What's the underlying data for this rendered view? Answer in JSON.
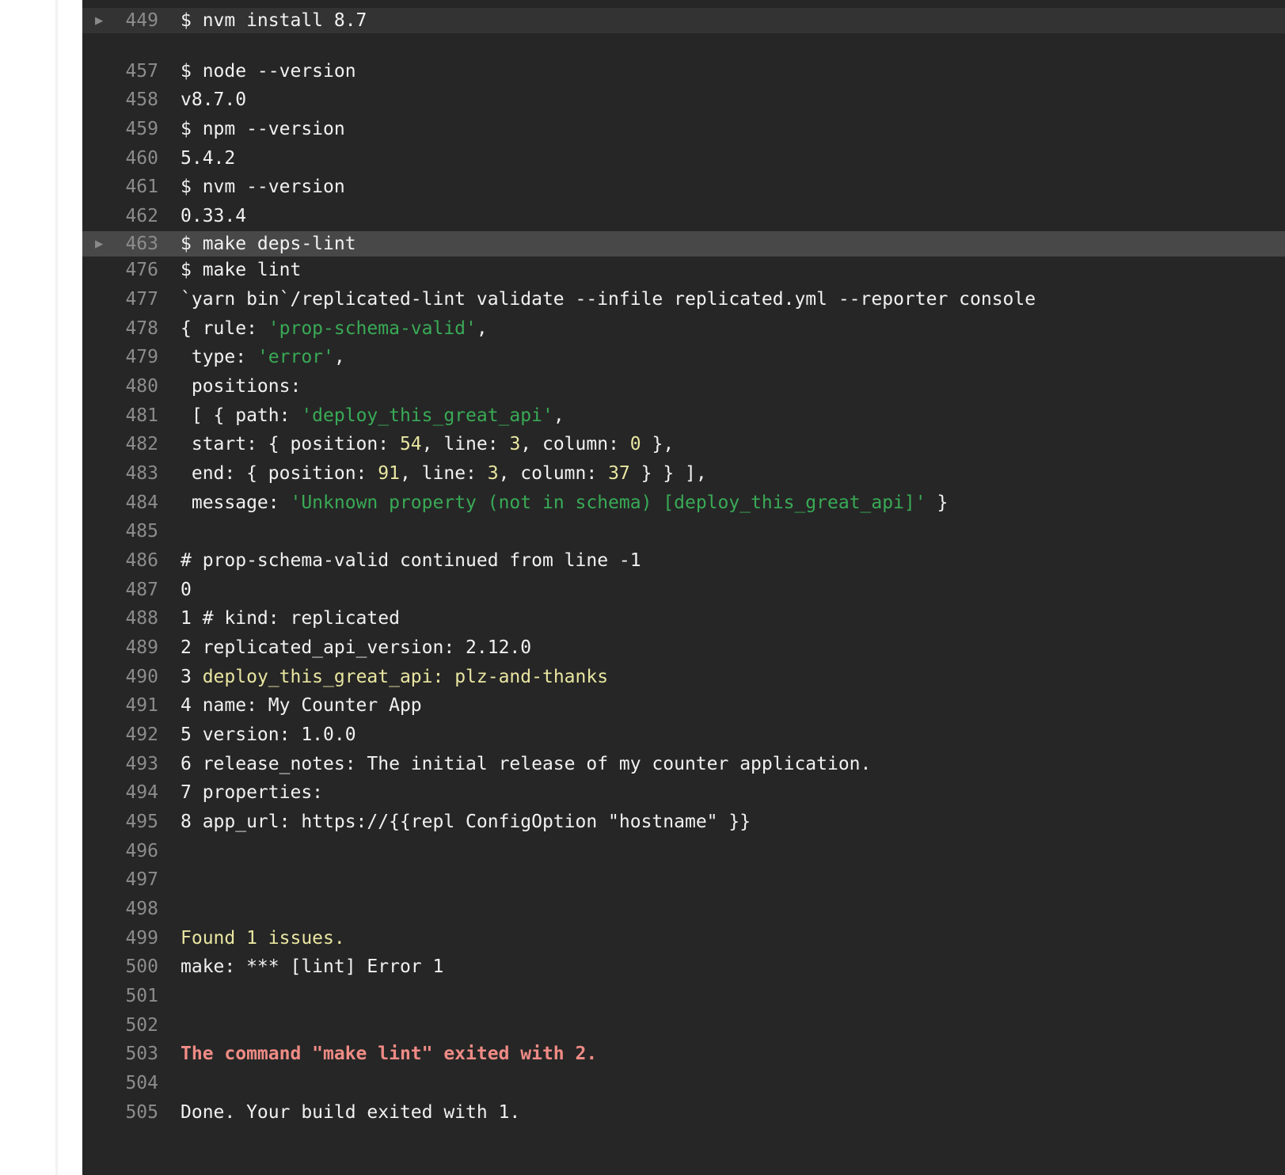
{
  "log": {
    "lines": [
      {
        "n": "449",
        "fold": true,
        "segs": [
          {
            "t": "$ nvm install 8.7"
          }
        ]
      },
      {
        "n": "457",
        "segs": [
          {
            "t": "$ node --version"
          }
        ]
      },
      {
        "n": "458",
        "segs": [
          {
            "t": "v8.7.0"
          }
        ]
      },
      {
        "n": "459",
        "segs": [
          {
            "t": "$ npm --version"
          }
        ]
      },
      {
        "n": "460",
        "segs": [
          {
            "t": "5.4.2"
          }
        ]
      },
      {
        "n": "461",
        "segs": [
          {
            "t": "$ nvm --version"
          }
        ]
      },
      {
        "n": "462",
        "segs": [
          {
            "t": "0.33.4"
          }
        ]
      },
      {
        "n": "463",
        "fold": true,
        "segs": [
          {
            "t": "$ make deps-lint"
          }
        ]
      },
      {
        "n": "476",
        "segs": [
          {
            "t": "$ make lint"
          }
        ]
      },
      {
        "n": "477",
        "segs": [
          {
            "t": "`yarn bin`/replicated-lint validate --infile replicated.yml --reporter console"
          }
        ]
      },
      {
        "n": "478",
        "segs": [
          {
            "t": "{ rule: "
          },
          {
            "t": "'prop-schema-valid'",
            "c": "g"
          },
          {
            "t": ","
          }
        ]
      },
      {
        "n": "479",
        "segs": [
          {
            "t": " type: "
          },
          {
            "t": "'error'",
            "c": "g"
          },
          {
            "t": ","
          }
        ]
      },
      {
        "n": "480",
        "segs": [
          {
            "t": " positions:"
          }
        ]
      },
      {
        "n": "481",
        "segs": [
          {
            "t": " [ { path: "
          },
          {
            "t": "'deploy_this_great_api'",
            "c": "g"
          },
          {
            "t": ","
          }
        ]
      },
      {
        "n": "482",
        "segs": [
          {
            "t": " start: { position: "
          },
          {
            "t": "54",
            "c": "y"
          },
          {
            "t": ", line: "
          },
          {
            "t": "3",
            "c": "y"
          },
          {
            "t": ", column: "
          },
          {
            "t": "0",
            "c": "y"
          },
          {
            "t": " },"
          }
        ]
      },
      {
        "n": "483",
        "segs": [
          {
            "t": " end: { position: "
          },
          {
            "t": "91",
            "c": "y"
          },
          {
            "t": ", line: "
          },
          {
            "t": "3",
            "c": "y"
          },
          {
            "t": ", column: "
          },
          {
            "t": "37",
            "c": "y"
          },
          {
            "t": " } } ],"
          }
        ]
      },
      {
        "n": "484",
        "segs": [
          {
            "t": " message: "
          },
          {
            "t": "'Unknown property (not in schema) [deploy_this_great_api]'",
            "c": "g"
          },
          {
            "t": " }"
          }
        ]
      },
      {
        "n": "485",
        "segs": []
      },
      {
        "n": "486",
        "segs": [
          {
            "t": "# prop-schema-valid continued from line -1"
          }
        ]
      },
      {
        "n": "487",
        "segs": [
          {
            "t": "0"
          }
        ]
      },
      {
        "n": "488",
        "segs": [
          {
            "t": "1 # kind: replicated"
          }
        ]
      },
      {
        "n": "489",
        "segs": [
          {
            "t": "2 replicated_api_version: 2.12.0"
          }
        ]
      },
      {
        "n": "490",
        "segs": [
          {
            "t": "3 "
          },
          {
            "t": "deploy_this_great_api: plz-and-thanks",
            "c": "yl"
          }
        ]
      },
      {
        "n": "491",
        "segs": [
          {
            "t": "4 name: My Counter App"
          }
        ]
      },
      {
        "n": "492",
        "segs": [
          {
            "t": "5 version: 1.0.0"
          }
        ]
      },
      {
        "n": "493",
        "segs": [
          {
            "t": "6 release_notes: The initial release of my counter application."
          }
        ]
      },
      {
        "n": "494",
        "segs": [
          {
            "t": "7 properties:"
          }
        ]
      },
      {
        "n": "495",
        "segs": [
          {
            "t": "8 app_url: https://{{repl ConfigOption \"hostname\" }}"
          }
        ]
      },
      {
        "n": "496",
        "segs": []
      },
      {
        "n": "497",
        "segs": []
      },
      {
        "n": "498",
        "segs": []
      },
      {
        "n": "499",
        "segs": [
          {
            "t": "Found 1 issues.",
            "c": "yl"
          }
        ]
      },
      {
        "n": "500",
        "segs": [
          {
            "t": "make: *** [lint] Error 1"
          }
        ]
      },
      {
        "n": "501",
        "segs": []
      },
      {
        "n": "502",
        "segs": []
      },
      {
        "n": "503",
        "segs": [
          {
            "t": "The command \"make lint\" exited with 2.",
            "c": "r"
          }
        ]
      },
      {
        "n": "504",
        "segs": []
      },
      {
        "n": "505",
        "segs": [
          {
            "t": "Done. Your build exited with 1."
          }
        ]
      }
    ]
  },
  "colors": {
    "background": "#262626",
    "string": "#39aa56",
    "number": "#e9e6a1",
    "error": "#ef8b85",
    "line_number": "#8c8c8c"
  },
  "icons": {
    "fold": "caret-right-icon"
  }
}
